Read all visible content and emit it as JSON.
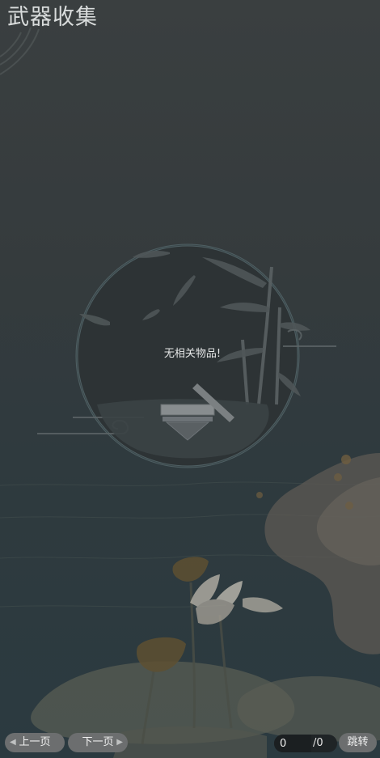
{
  "title": "武器收集",
  "empty_message": "无相关物品!",
  "pagination": {
    "prev_label": "上一页",
    "next_label": "下一页",
    "current_page": "0",
    "total_pages": "/0",
    "jump_label": "跳转"
  },
  "icons": {
    "prev": "triangle-left-icon",
    "next": "triangle-right-icon"
  },
  "colors": {
    "background_top": "#3a3f40",
    "background_bottom": "#2b3a40",
    "title_text": "#d9dcdc",
    "button_bg": "#6c6e6f",
    "input_bg": "#1b1f21"
  }
}
